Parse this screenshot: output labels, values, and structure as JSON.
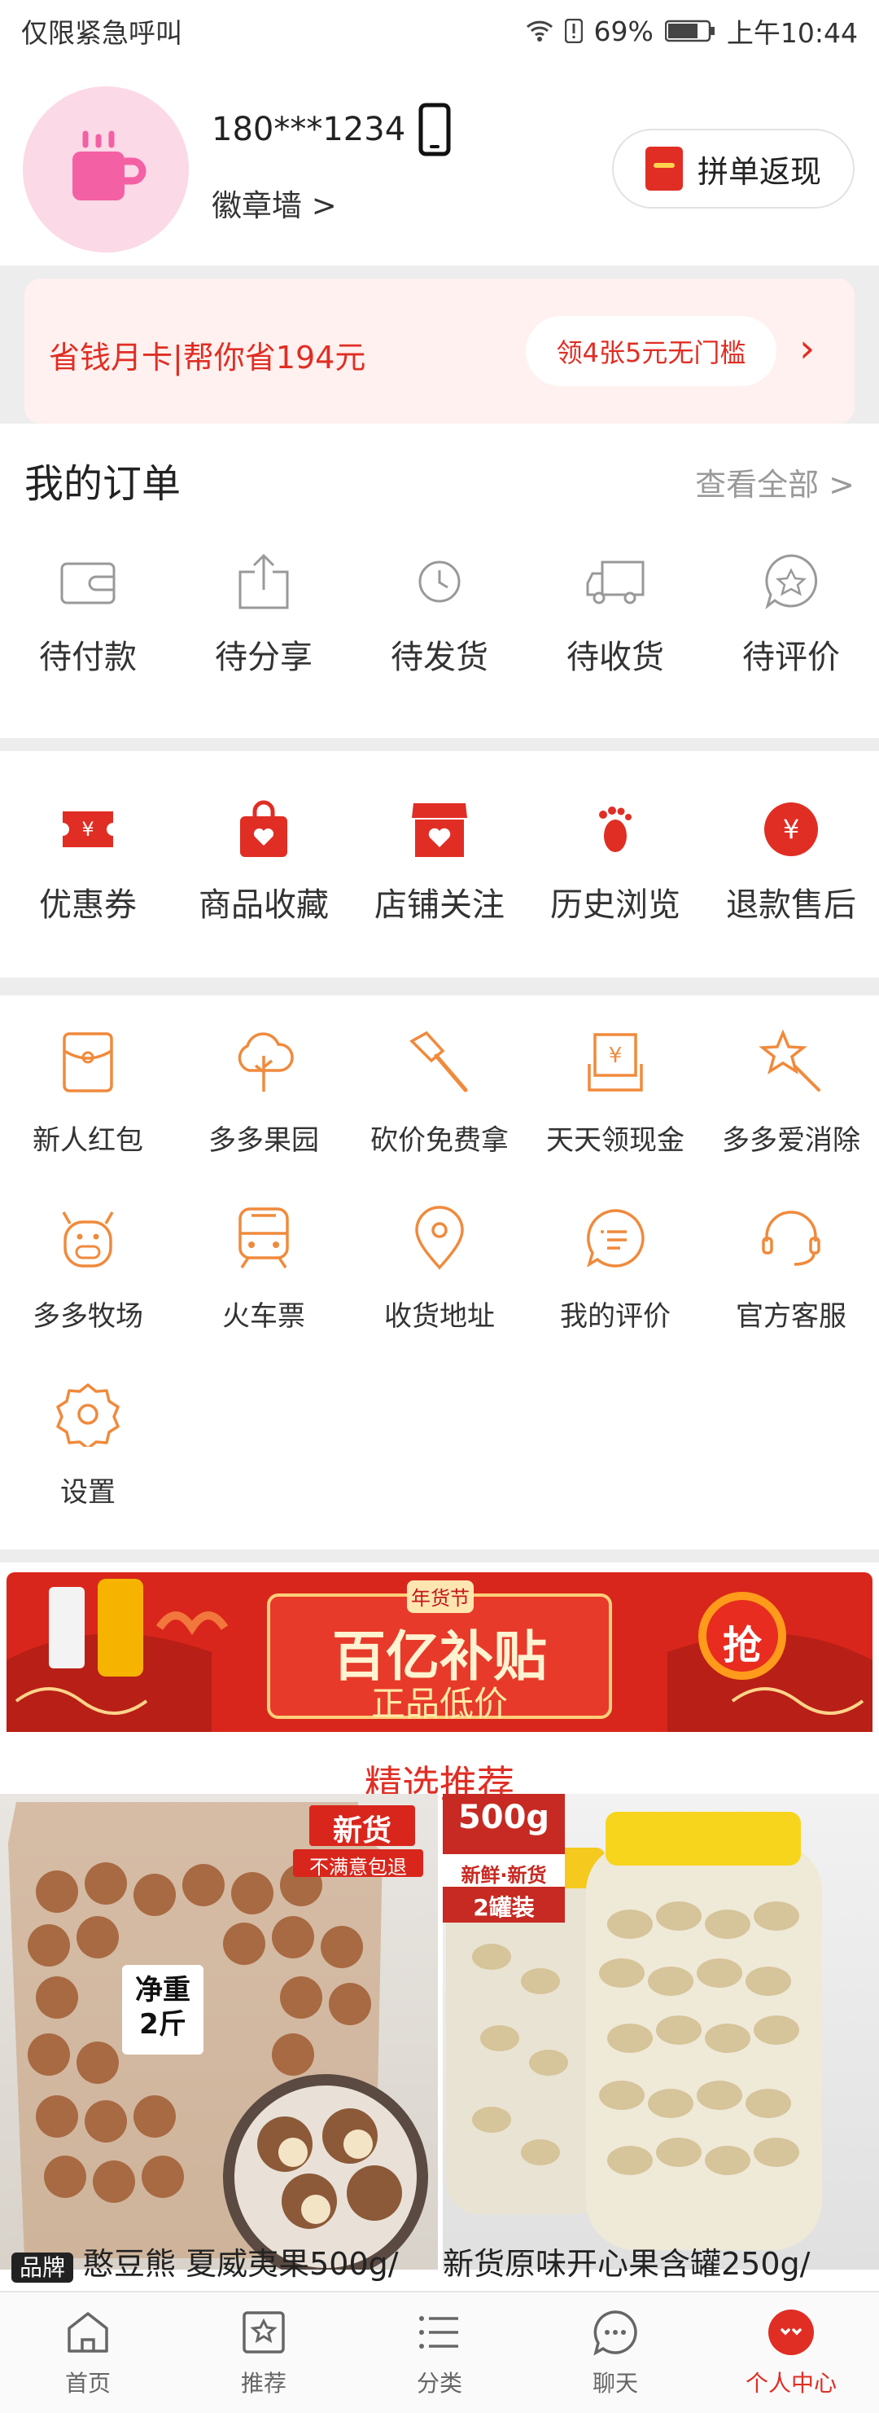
{
  "status_bar": {
    "left_text": "仅限紧急呼叫",
    "battery": "69%",
    "time": "上午10:44"
  },
  "profile": {
    "phone": "180***1234",
    "badge_wall": "徽章墙 >",
    "group_button": "拼单返现"
  },
  "saving_card": {
    "text": "省钱月卡|帮你省194元",
    "button": "领4张5元无门槛",
    "arrow": "›"
  },
  "orders": {
    "title": "我的订单",
    "view_all": "查看全部 >",
    "items": [
      {
        "label": "待付款",
        "icon": "wallet-icon"
      },
      {
        "label": "待分享",
        "icon": "share-icon"
      },
      {
        "label": "待发货",
        "icon": "clock-icon"
      },
      {
        "label": "待收货",
        "icon": "truck-icon"
      },
      {
        "label": "待评价",
        "icon": "star-bubble-icon"
      }
    ]
  },
  "favorites": {
    "items": [
      {
        "label": "优惠券",
        "icon": "coupon-icon"
      },
      {
        "label": "商品收藏",
        "icon": "bag-heart-icon"
      },
      {
        "label": "店铺关注",
        "icon": "store-heart-icon"
      },
      {
        "label": "历史浏览",
        "icon": "footprint-icon"
      },
      {
        "label": "退款售后",
        "icon": "refund-icon"
      }
    ]
  },
  "tools": {
    "items": [
      {
        "label": "新人红包",
        "icon": "envelope-icon"
      },
      {
        "label": "多多果园",
        "icon": "tree-icon"
      },
      {
        "label": "砍价免费拿",
        "icon": "axe-icon"
      },
      {
        "label": "天天领现金",
        "icon": "cash-icon"
      },
      {
        "label": "多多爱消除",
        "icon": "star-wand-icon"
      },
      {
        "label": "多多牧场",
        "icon": "cow-icon"
      },
      {
        "label": "火车票",
        "icon": "train-icon"
      },
      {
        "label": "收货地址",
        "icon": "location-icon"
      },
      {
        "label": "我的评价",
        "icon": "comment-icon"
      },
      {
        "label": "官方客服",
        "icon": "headset-icon"
      },
      {
        "label": "设置",
        "icon": "gear-icon"
      }
    ]
  },
  "banner": {
    "tag": "年货节",
    "headline": "百亿补贴",
    "sub": "正品低价",
    "grab": "抢"
  },
  "recommend": {
    "title": "精选推荐",
    "products": [
      {
        "brand": "品牌",
        "title": "憨豆熊 夏威夷果500g/",
        "badge1": "新货",
        "badge2": "不满意包退",
        "weight": "净重 2斤"
      },
      {
        "title": "新货原味开心果含罐250g/",
        "badge1": "500g",
        "badge2": "新鲜·新货",
        "badge3": "2罐装"
      }
    ]
  },
  "bottom_nav": {
    "items": [
      {
        "label": "首页",
        "icon": "home-icon"
      },
      {
        "label": "推荐",
        "icon": "recommend-icon"
      },
      {
        "label": "分类",
        "icon": "list-icon"
      },
      {
        "label": "聊天",
        "icon": "chat-icon"
      },
      {
        "label": "个人中心",
        "icon": "profile-icon"
      }
    ]
  },
  "colors": {
    "accent": "#e02e24",
    "orange": "#f08a3c"
  }
}
